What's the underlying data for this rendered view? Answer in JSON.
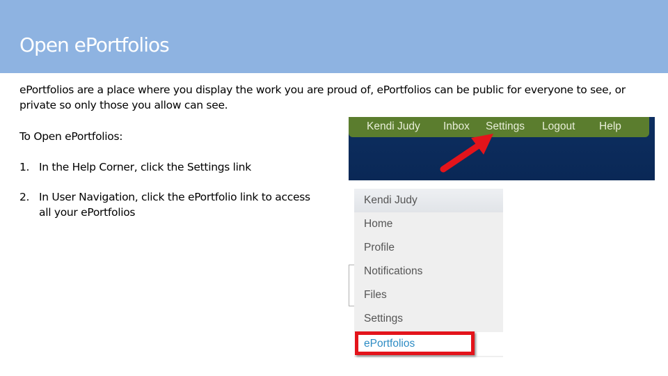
{
  "slide": {
    "title": "Open ePortfolios",
    "intro": "ePortfolios are a place where you display the work you are proud of, ePortfolios can be public for everyone to see, or private so only those you allow can see.",
    "subhead": "To Open ePortfolios:",
    "steps": [
      {
        "num": "1.",
        "text": "In the Help Corner, click the Settings link"
      },
      {
        "num": "2.",
        "text": "In User Navigation, click the ePortfolio link to access all your ePortfolios"
      }
    ]
  },
  "help_corner": {
    "links": [
      "Kendi Judy",
      "Inbox",
      "Settings",
      "Logout",
      "Help"
    ],
    "highlighted": "Settings",
    "bar_color": "#5b7d2e",
    "background_color": "#0c2b5c",
    "annotation": "red-arrow-pointing-to-settings"
  },
  "user_navigation": {
    "header": "Kendi Judy",
    "items": [
      "Home",
      "Profile",
      "Notifications",
      "Files",
      "Settings",
      "ePortfolios"
    ],
    "highlighted": "ePortfolios",
    "link_color": "#2d8cc4",
    "annotation": "red-box-around-eportfolios"
  },
  "colors": {
    "title_bar": "#8eb3e1",
    "annotation_red": "#e3141b"
  }
}
